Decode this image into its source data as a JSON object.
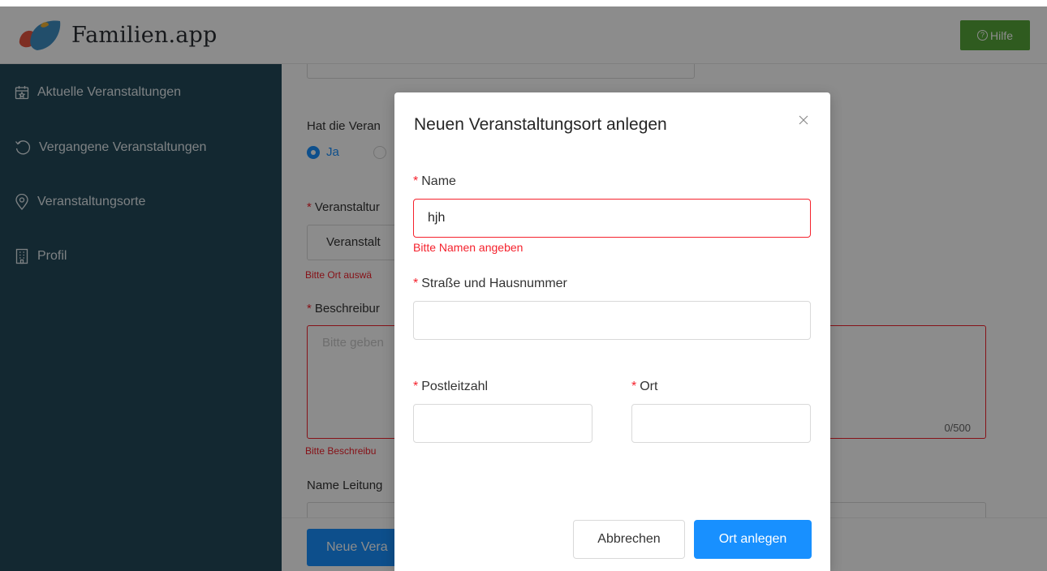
{
  "app": {
    "name": "Familien.app",
    "help_label": "Hilfe"
  },
  "sidebar": {
    "items": [
      {
        "label": "Aktuelle Veranstaltungen",
        "icon": "calendar-star-icon"
      },
      {
        "label": "Vergangene Veranstaltungen",
        "icon": "history-icon"
      },
      {
        "label": "Veranstaltungsorte",
        "icon": "location-pin-icon"
      },
      {
        "label": "Profil",
        "icon": "building-icon"
      }
    ]
  },
  "form": {
    "question_label": "Hat die Veran",
    "radio_yes": "Ja",
    "location_label": "Veranstaltur",
    "location_value": "Veranstalt",
    "location_error": "Bitte Ort auswä",
    "description_label": "Beschreibur",
    "description_placeholder": "Bitte geben",
    "description_counter": "0/500",
    "description_error": "Bitte Beschreibu",
    "leader_label": "Name Leitung",
    "new_button": "Neue Vera"
  },
  "modal": {
    "title": "Neuen Veranstaltungsort anlegen",
    "name_label": "Name",
    "name_value": "hjh",
    "name_error": "Bitte Namen angeben",
    "street_label": "Straße und Hausnummer",
    "street_value": "",
    "zip_label": "Postleitzahl",
    "zip_value": "",
    "city_label": "Ort",
    "city_value": "",
    "cancel_label": "Abbrechen",
    "submit_label": "Ort anlegen"
  },
  "colors": {
    "sidebar": "#23495a",
    "primary": "#1890ff",
    "help": "#56a63a",
    "error": "#f5222d"
  }
}
